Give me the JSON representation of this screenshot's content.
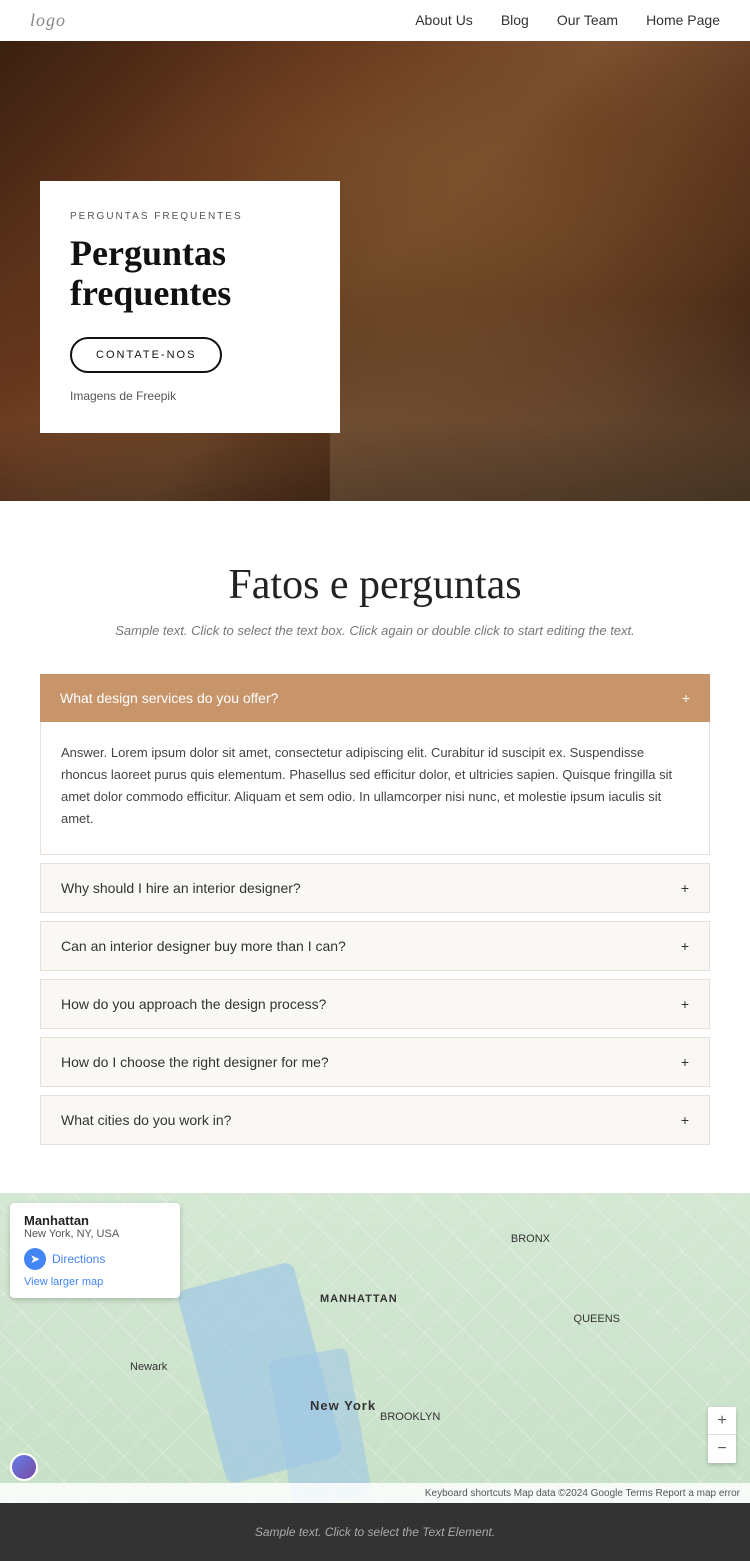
{
  "nav": {
    "logo": "logo",
    "links": [
      {
        "label": "About Us",
        "href": "#"
      },
      {
        "label": "Blog",
        "href": "#"
      },
      {
        "label": "Our Team",
        "href": "#"
      },
      {
        "label": "Home Page",
        "href": "#"
      }
    ]
  },
  "hero": {
    "tag": "PERGUNTAS FREQUENTES",
    "title": "Perguntas frequentes",
    "button_label": "CONTATE-NOS",
    "credit": "Imagens de",
    "credit_link": "Freepik"
  },
  "faq_section": {
    "title": "Fatos e perguntas",
    "subtitle": "Sample text. Click to select the text box. Click again or double click to start editing the text.",
    "open_question": {
      "question": "What design services do you offer?",
      "answer": "Answer. Lorem ipsum dolor sit amet, consectetur adipiscing elit. Curabitur id suscipit ex. Suspendisse rhoncus laoreet purus quis elementum. Phasellus sed efficitur dolor, et ultricies sapien. Quisque fringilla sit amet dolor commodo efficitur. Aliquam et sem odio. In ullamcorper nisi nunc, et molestie ipsum iaculis sit amet."
    },
    "questions": [
      {
        "question": "Why should I hire an interior designer?"
      },
      {
        "question": "Can an interior designer buy more than I can?"
      },
      {
        "question": "How do you approach the design process?"
      },
      {
        "question": "How do I choose the right designer for me?"
      },
      {
        "question": "What cities do you work in?"
      }
    ]
  },
  "map": {
    "title": "Manhattan",
    "address": "New York, NY, USA",
    "directions_label": "Directions",
    "view_larger": "View larger map",
    "labels": {
      "nyc": "New York",
      "manhattan": "MANHATTAN",
      "bronx": "BRONX",
      "brooklyn": "BROOKLYN",
      "queens": "QUEENS",
      "newark": "Newark"
    },
    "zoom_in": "+",
    "zoom_out": "−",
    "footer_text": "Keyboard shortcuts  Map data ©2024 Google  Terms  Report a map error"
  },
  "footer": {
    "text": "Sample text. Click to select the Text Element."
  }
}
